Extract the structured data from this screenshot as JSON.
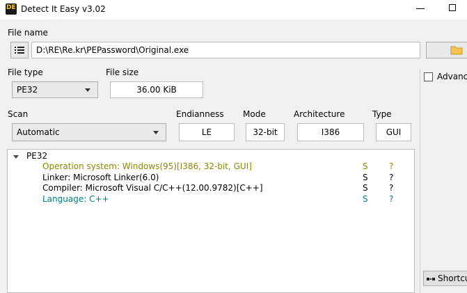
{
  "window": {
    "title": "Detect It Easy v3.02",
    "icon_letters": "DE"
  },
  "file": {
    "label": "File name",
    "path": "D:\\RE\\Re.kr\\PEPassword\\Original.exe"
  },
  "file_type": {
    "label": "File type",
    "value": "PE32"
  },
  "file_size": {
    "label": "File size",
    "value": "36.00 KiB"
  },
  "scan": {
    "label": "Scan",
    "value": "Automatic"
  },
  "endianness": {
    "label": "Endianness",
    "value": "LE"
  },
  "mode": {
    "label": "Mode",
    "value": "32-bit"
  },
  "architecture": {
    "label": "Architecture",
    "value": "I386"
  },
  "type": {
    "label": "Type",
    "value": "GUI"
  },
  "advanced": {
    "label": "Advanced",
    "checked": false
  },
  "shortcuts": {
    "label": "Shortcuts"
  },
  "results": {
    "root": "PE32",
    "items": [
      {
        "text": "Operation system: Windows(95)[I386, 32-bit, GUI]",
        "s": "S",
        "q": "?",
        "color": "#8a8a00"
      },
      {
        "text": "Linker: Microsoft Linker(6.0)",
        "s": "S",
        "q": "?",
        "color": "#000000"
      },
      {
        "text": "Compiler: Microsoft Visual C/C++(12.00.9782)[C++]",
        "s": "S",
        "q": "?",
        "color": "#000000"
      },
      {
        "text": "Language: C++",
        "s": "S",
        "q": "?",
        "color": "#008080"
      }
    ]
  },
  "icons": {
    "list": "list-icon",
    "folder": "folder-icon"
  }
}
